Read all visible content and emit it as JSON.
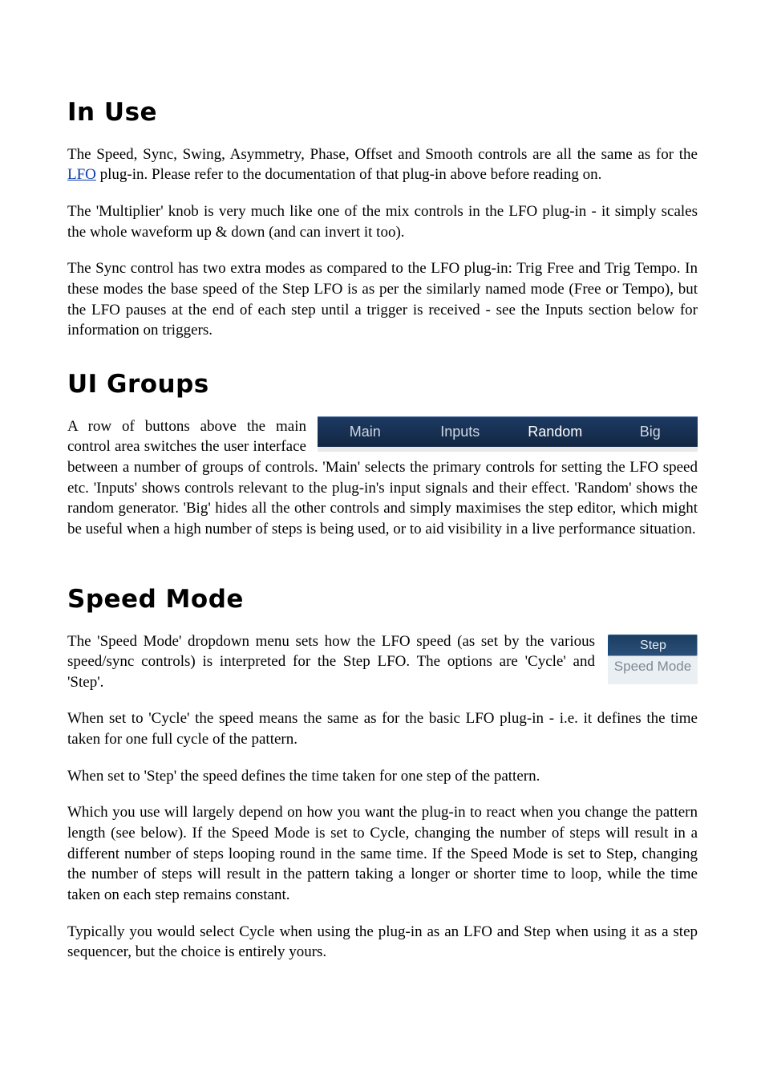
{
  "sections": {
    "in_use": {
      "heading": "In Use",
      "p1_prefix": "The Speed, Sync, Swing, Asymmetry, Phase, Offset and Smooth controls are all the same as for the ",
      "p1_link": "LFO",
      "p1_suffix": " plug-in. Please refer to the documentation of that plug-in above before reading on.",
      "p2": "The 'Multiplier' knob is very much like one of the mix controls in the LFO plug-in - it simply scales the whole waveform up & down (and can invert it too).",
      "p3": "The Sync control has two extra modes as compared to the LFO plug-in: Trig Free and Trig Tempo. In these modes the base speed of the Step LFO is as per the similarly named mode (Free or Tempo), but the LFO pauses at the end of each step until a trigger is received - see the Inputs section below for information on triggers."
    },
    "ui_groups": {
      "heading": "UI Groups",
      "tabs": {
        "main": "Main",
        "inputs": "Inputs",
        "random": "Random",
        "big": "Big"
      },
      "p1": "A row of buttons above the main control area switches the user interface between a number of groups of controls. 'Main' selects the primary controls for setting the LFO speed etc. 'Inputs' shows controls relevant to the plug-in's input signals and their effect. 'Random' shows the random generator. 'Big' hides all the other controls and simply maximises the step editor, which might be useful when a high number of steps is being used, or to aid visibility in a live performance situation."
    },
    "speed_mode": {
      "heading": "Speed Mode",
      "dropdown_value": "Step",
      "dropdown_label": "Speed Mode",
      "p1": "The 'Speed Mode' dropdown menu sets how the LFO speed  (as set by the various speed/sync controls) is interpreted for the Step LFO. The options are 'Cycle' and 'Step'.",
      "p2": "When set to 'Cycle' the speed means the same as for the basic LFO plug-in - i.e. it defines the time taken for one full cycle of the pattern.",
      "p3": "When set to 'Step' the speed defines the time taken for one step of the pattern.",
      "p4": "Which you use will largely depend on how you want the plug-in to react when you change the pattern length (see below). If the Speed Mode is set to Cycle, changing the number of steps will result in a different number of steps looping round in the same time. If the Speed Mode is set to Step, changing the number of steps will result in the pattern taking a longer or shorter time to loop, while the time taken on each step remains constant.",
      "p5": "Typically you would select Cycle when using the plug-in as an LFO and Step when using it as a step sequencer, but the choice is entirely yours."
    }
  }
}
